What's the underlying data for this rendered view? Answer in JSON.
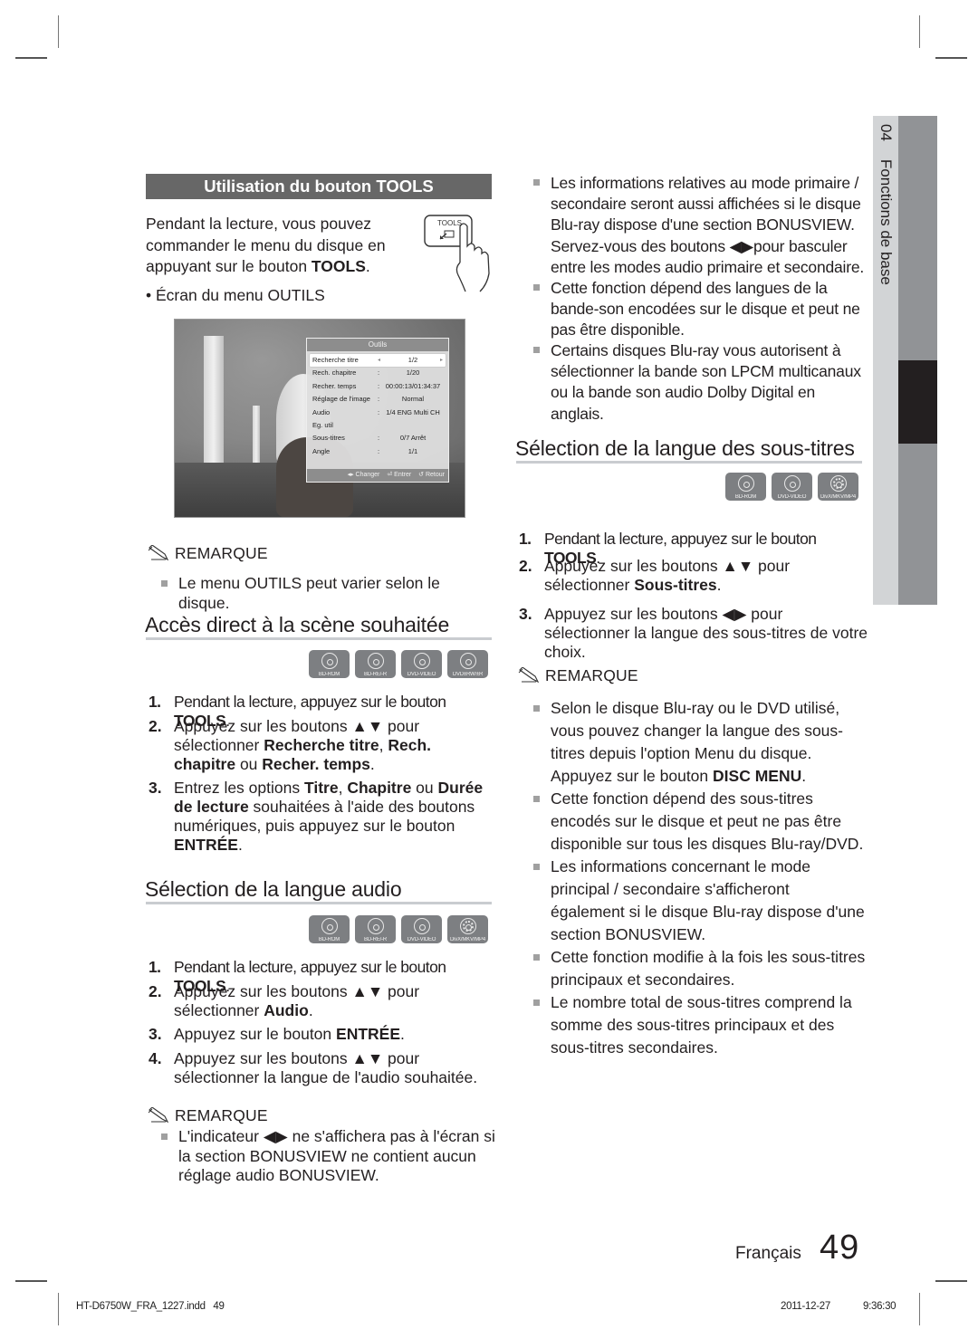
{
  "tools_section": {
    "banner": "Utilisation du bouton TOOLS",
    "intro_pre": "Pendant la lecture, vous pouvez commander le menu du disque en appuyant sur le bouton ",
    "intro_bold": "TOOLS",
    "intro_post": ".",
    "bullet": "• Écran du menu OUTILS",
    "tools_icon_label": "TOOLS",
    "tools_icon": "hand-pressing-tools-button-icon"
  },
  "osd_menu": {
    "title": "Outils",
    "rows": [
      {
        "label": "Recherche titre",
        "separator": "",
        "value": "1/2",
        "selected": true
      },
      {
        "label": "Rech. chapitre",
        "separator": ":",
        "value": "1/20"
      },
      {
        "label": "Recher. temps",
        "separator": ":",
        "value": "00:00:13/01:34:37"
      },
      {
        "label": "Réglage de l'image",
        "separator": ":",
        "value": "Normal"
      },
      {
        "label": "Audio",
        "separator": ":",
        "value": "1/4 ENG Multi CH"
      },
      {
        "label": "Eg. util",
        "separator": "",
        "value": ""
      },
      {
        "label": "Sous-titres",
        "separator": ":",
        "value": "0/7 Arrêt"
      },
      {
        "label": "Angle",
        "separator": ":",
        "value": "1/1"
      }
    ],
    "footer": {
      "change": "◂▸ Changer",
      "enter": "⏎ Entrer",
      "back": "↺ Retour"
    }
  },
  "remarque_label": "REMARQUE",
  "note1": "Le menu OUTILS peut varier selon le disque.",
  "direct_access": {
    "title": "Accès direct à la scène souhaitée",
    "discs": [
      "BD-ROM",
      "BD-RE/-R",
      "DVD-VIDEO",
      "DVD±RW/±R"
    ],
    "steps": [
      {
        "num": "1.",
        "parts": [
          [
            "Pendant la lecture, appuyez sur le bouton ",
            false
          ],
          [
            "TOOLS",
            true
          ],
          [
            ".",
            false
          ]
        ]
      },
      {
        "num": "2.",
        "parts": [
          [
            "Appuyez sur les boutons ▲▼ pour sélectionner ",
            false
          ],
          [
            "Recherche titre",
            true
          ],
          [
            ", ",
            false
          ],
          [
            "Rech. chapitre",
            true
          ],
          [
            " ou ",
            false
          ],
          [
            "Recher. temps",
            true
          ],
          [
            ".",
            false
          ]
        ]
      },
      {
        "num": "3.",
        "parts": [
          [
            "Entrez les options ",
            false
          ],
          [
            "Titre",
            true
          ],
          [
            ", ",
            false
          ],
          [
            "Chapitre",
            true
          ],
          [
            " ou ",
            false
          ],
          [
            "Durée de lecture",
            true
          ],
          [
            " souhaitées à l'aide des boutons numériques, puis appuyez sur le bouton ",
            false
          ],
          [
            "ENTRÉE",
            true
          ],
          [
            ".",
            false
          ]
        ]
      }
    ]
  },
  "audio_lang": {
    "title": "Sélection de la langue audio",
    "discs": [
      "BD-ROM",
      "BD-RE/-R",
      "DVD-VIDEO",
      "DivX/MKV/MP4"
    ],
    "steps": [
      {
        "num": "1.",
        "parts": [
          [
            "Pendant la lecture, appuyez sur le bouton ",
            false
          ],
          [
            "TOOLS",
            true
          ],
          [
            ".",
            false
          ]
        ]
      },
      {
        "num": "2.",
        "parts": [
          [
            "Appuyez sur les boutons ▲▼ pour sélectionner ",
            false
          ],
          [
            "Audio",
            true
          ],
          [
            ".",
            false
          ]
        ]
      },
      {
        "num": "3.",
        "parts": [
          [
            "Appuyez sur le bouton ",
            false
          ],
          [
            "ENTRÉE",
            true
          ],
          [
            ".",
            false
          ]
        ]
      },
      {
        "num": "4.",
        "parts": [
          [
            "Appuyez sur les boutons ▲▼ pour sélectionner la langue de l'audio souhaitée.",
            false
          ]
        ]
      }
    ],
    "note": "L'indicateur ◀▶ ne s'affichera pas à l'écran si la section BONUSVIEW ne contient aucun réglage audio BONUSVIEW."
  },
  "audio_notes_right": [
    "Les informations relatives au mode primaire / secondaire seront aussi affichées si le disque Blu-ray dispose d'une section BONUSVIEW. Servez-vous des boutons ◀▶pour basculer entre les modes audio primaire et secondaire.",
    "Cette fonction dépend des langues de la bande-son encodées sur le disque et peut ne pas être disponible.",
    "Certains disques Blu-ray vous autorisent à sélectionner la bande son LPCM multicanaux ou la bande son audio Dolby Digital en anglais."
  ],
  "subtitle_lang": {
    "title": "Sélection de la langue des sous-titres",
    "discs": [
      "BD-ROM",
      "DVD-VIDEO",
      "DivX/MKV/MP4"
    ],
    "steps": [
      {
        "num": "1.",
        "parts": [
          [
            "Pendant la lecture, appuyez sur le bouton ",
            false
          ],
          [
            "TOOLS",
            true
          ],
          [
            ".",
            false
          ]
        ]
      },
      {
        "num": "2.",
        "parts": [
          [
            "Appuyez sur les boutons ▲▼ pour sélectionner ",
            false
          ],
          [
            "Sous-titres",
            true
          ],
          [
            ".",
            false
          ]
        ]
      },
      {
        "num": "3.",
        "parts": [
          [
            "Appuyez sur les boutons ◀▶ pour sélectionner la langue des sous-titres de votre choix.",
            false
          ]
        ]
      }
    ],
    "notes": [
      {
        "parts": [
          [
            "Selon le disque Blu-ray ou le DVD utilisé, vous pouvez changer la langue des sous-titres depuis l'option Menu du disque.",
            false
          ],
          [
            "\n",
            false
          ],
          [
            "Appuyez sur le bouton ",
            false
          ],
          [
            "DISC MENU",
            true
          ],
          [
            ".",
            false
          ]
        ]
      },
      {
        "parts": [
          [
            "Cette fonction dépend des sous-titres encodés sur le disque et peut ne pas être disponible sur tous les disques Blu-ray/DVD.",
            false
          ]
        ]
      },
      {
        "parts": [
          [
            "Les informations concernant le mode principal / secondaire s'afficheront également si le disque Blu-ray dispose d'une section BONUSVIEW.",
            false
          ]
        ]
      },
      {
        "parts": [
          [
            "Cette fonction modifie à la fois les sous-titres principaux et secondaires.",
            false
          ]
        ]
      },
      {
        "parts": [
          [
            "Le nombre total de sous-titres comprend la somme des sous-titres principaux et des sous-titres secondaires.",
            false
          ]
        ]
      }
    ]
  },
  "side_tab": {
    "chapter_num": "04",
    "chapter_title": "Fonctions de base"
  },
  "footer": {
    "language": "Français",
    "page_number": "49"
  },
  "slug": {
    "file": "HT-D6750W_FRA_1227.indd   49",
    "date": "2011-12-27",
    "time": "9:36:30"
  }
}
